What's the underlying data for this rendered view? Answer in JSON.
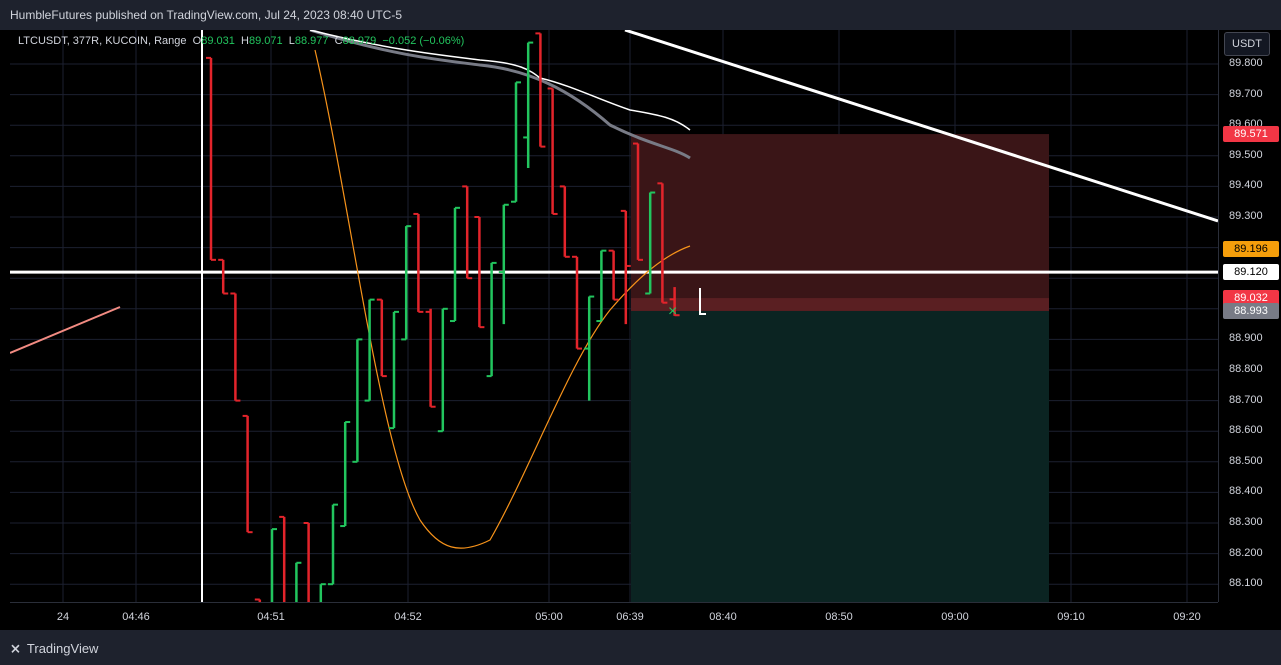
{
  "header": {
    "text": "HumbleFutures published on TradingView.com, Jul 24, 2023 08:40 UTC-5"
  },
  "legend": {
    "symbol": "LTCUSDT, 377R, KUCOIN, Range",
    "open_label": "O",
    "open": "89.031",
    "high_label": "H",
    "high": "89.071",
    "low_label": "L",
    "low": "88.977",
    "close_label": "C",
    "close": "88.979",
    "change": "−0.052 (−0.06%)"
  },
  "currency": "USDT",
  "price_ticks": [
    "89.800",
    "89.700",
    "89.600",
    "89.500",
    "89.400",
    "89.300",
    "89.200",
    "89.100",
    "89.000",
    "88.900",
    "88.800",
    "88.700",
    "88.600",
    "88.500",
    "88.400",
    "88.300",
    "88.200",
    "88.100"
  ],
  "badges": [
    {
      "text": "89.571",
      "bg": "#f23645",
      "fg": "#ffffff",
      "price": 89.571
    },
    {
      "text": "89.196",
      "bg": "#f59e0b",
      "fg": "#000000",
      "price": 89.196
    },
    {
      "text": "89.120",
      "bg": "#ffffff",
      "fg": "#000000",
      "price": 89.12
    },
    {
      "text": "89.032",
      "bg": "#f23645",
      "fg": "#ffffff",
      "price": 89.035
    },
    {
      "text": "88.993",
      "bg": "#787b86",
      "fg": "#ffffff",
      "price": 88.993
    }
  ],
  "time_labels": [
    "24",
    "04:46",
    "04:51",
    "04:52",
    "05:00",
    "06:39",
    "08:40",
    "08:50",
    "09:00",
    "09:10",
    "09:20"
  ],
  "colors": {
    "up": "#22c55e",
    "down": "#e3242b",
    "stop_zone": "#3a1517",
    "target_zone": "#0b2422",
    "ma": "#f7931a"
  },
  "chart_data": {
    "type": "bar",
    "bars": [
      {
        "o": 89.82,
        "h": 89.82,
        "l": 89.16,
        "c": 89.16
      },
      {
        "o": 89.16,
        "h": 89.16,
        "l": 89.05,
        "c": 89.05
      },
      {
        "o": 89.05,
        "h": 89.05,
        "l": 88.7,
        "c": 88.7
      },
      {
        "o": 88.65,
        "h": 88.65,
        "l": 88.27,
        "c": 88.27
      },
      {
        "o": 88.05,
        "h": 88.05,
        "l": 87.9,
        "c": 87.9
      },
      {
        "o": 87.9,
        "h": 88.28,
        "l": 87.9,
        "c": 88.28
      },
      {
        "o": 88.32,
        "h": 88.32,
        "l": 87.9,
        "c": 87.9
      },
      {
        "o": 87.95,
        "h": 88.17,
        "l": 87.95,
        "c": 88.17
      },
      {
        "o": 88.3,
        "h": 88.3,
        "l": 87.9,
        "c": 87.9
      },
      {
        "o": 87.95,
        "h": 88.1,
        "l": 87.95,
        "c": 88.1
      },
      {
        "o": 88.1,
        "h": 88.36,
        "l": 88.1,
        "c": 88.36
      },
      {
        "o": 88.29,
        "h": 88.63,
        "l": 88.29,
        "c": 88.63
      },
      {
        "o": 88.5,
        "h": 88.9,
        "l": 88.5,
        "c": 88.9
      },
      {
        "o": 88.7,
        "h": 89.03,
        "l": 88.7,
        "c": 89.03
      },
      {
        "o": 89.03,
        "h": 89.03,
        "l": 88.78,
        "c": 88.78
      },
      {
        "o": 88.61,
        "h": 88.99,
        "l": 88.61,
        "c": 88.99
      },
      {
        "o": 88.9,
        "h": 89.27,
        "l": 88.9,
        "c": 89.27
      },
      {
        "o": 89.31,
        "h": 89.31,
        "l": 88.99,
        "c": 88.99
      },
      {
        "o": 88.99,
        "h": 89.0,
        "l": 88.68,
        "c": 88.68
      },
      {
        "o": 88.6,
        "h": 89.0,
        "l": 88.6,
        "c": 89.0
      },
      {
        "o": 88.96,
        "h": 89.33,
        "l": 88.96,
        "c": 89.33
      },
      {
        "o": 89.4,
        "h": 89.4,
        "l": 89.1,
        "c": 89.1
      },
      {
        "o": 89.3,
        "h": 89.3,
        "l": 88.94,
        "c": 88.94
      },
      {
        "o": 88.78,
        "h": 89.15,
        "l": 88.78,
        "c": 89.15
      },
      {
        "o": 89.12,
        "h": 89.34,
        "l": 88.95,
        "c": 89.34
      },
      {
        "o": 89.35,
        "h": 89.74,
        "l": 89.35,
        "c": 89.74
      },
      {
        "o": 89.56,
        "h": 89.87,
        "l": 89.46,
        "c": 89.87
      },
      {
        "o": 89.9,
        "h": 89.9,
        "l": 89.53,
        "c": 89.53
      },
      {
        "o": 89.72,
        "h": 89.72,
        "l": 89.31,
        "c": 89.31
      },
      {
        "o": 89.4,
        "h": 89.4,
        "l": 89.17,
        "c": 89.17
      },
      {
        "o": 89.17,
        "h": 89.17,
        "l": 88.87,
        "c": 88.87
      },
      {
        "o": 88.87,
        "h": 89.04,
        "l": 88.7,
        "c": 89.04
      },
      {
        "o": 88.96,
        "h": 89.19,
        "l": 88.96,
        "c": 89.19
      },
      {
        "o": 89.19,
        "h": 89.19,
        "l": 89.03,
        "c": 89.03
      },
      {
        "o": 89.32,
        "h": 89.32,
        "l": 88.95,
        "c": 89.14
      },
      {
        "o": 89.54,
        "h": 89.54,
        "l": 89.16,
        "c": 89.16
      },
      {
        "o": 89.05,
        "h": 89.38,
        "l": 89.05,
        "c": 89.38
      },
      {
        "o": 89.41,
        "h": 89.41,
        "l": 89.02,
        "c": 89.02
      },
      {
        "o": 89.031,
        "h": 89.071,
        "l": 88.977,
        "c": 88.979
      }
    ]
  }
}
